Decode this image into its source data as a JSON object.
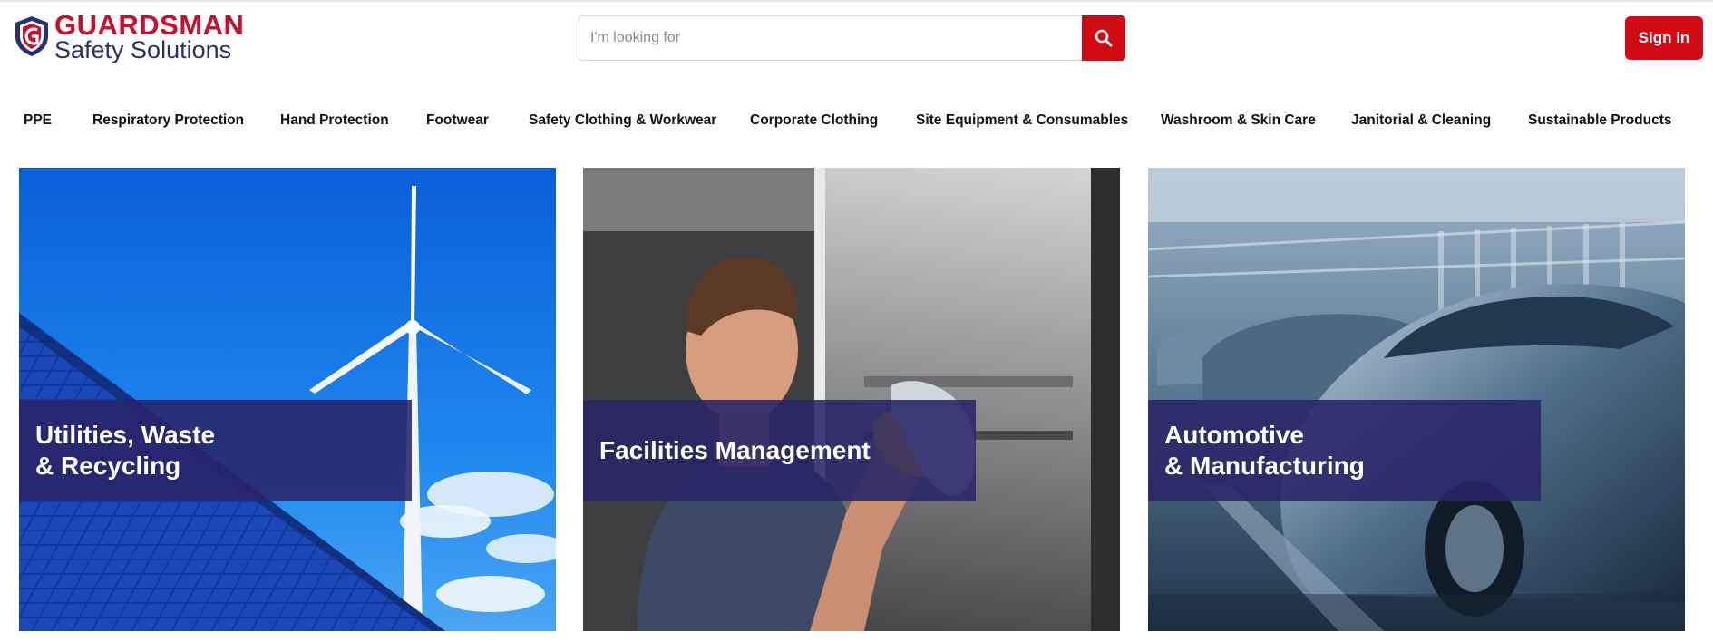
{
  "brand": {
    "name": "GUARDSMAN",
    "tagline": "Safety Solutions",
    "logo_icon": "shield-g-icon",
    "colors": {
      "red": "#c8102e",
      "navy": "#2b2f6b"
    }
  },
  "search": {
    "placeholder": "I'm looking for",
    "value": "",
    "button_icon": "search-icon"
  },
  "header": {
    "signin_label": "Sign in"
  },
  "nav": {
    "items": [
      {
        "label": "PPE"
      },
      {
        "label": "Respiratory Protection"
      },
      {
        "label": "Hand Protection"
      },
      {
        "label": "Footwear"
      },
      {
        "label": "Safety Clothing & Workwear"
      },
      {
        "label": "Corporate Clothing"
      },
      {
        "label": "Site Equipment & Consumables"
      },
      {
        "label": "Washroom & Skin Care"
      },
      {
        "label": "Janitorial & Cleaning"
      },
      {
        "label": "Sustainable Products"
      }
    ]
  },
  "tiles": [
    {
      "title": "Utilities, Waste\n& Recycling",
      "image": "wind-turbine-solar-panels"
    },
    {
      "title": "Facilities Management",
      "image": "person-cleaning-glass"
    },
    {
      "title": "Automotive\n& Manufacturing",
      "image": "car-production-line"
    }
  ],
  "colors": {
    "accent": "#d10a14",
    "overlay": "#282468"
  }
}
